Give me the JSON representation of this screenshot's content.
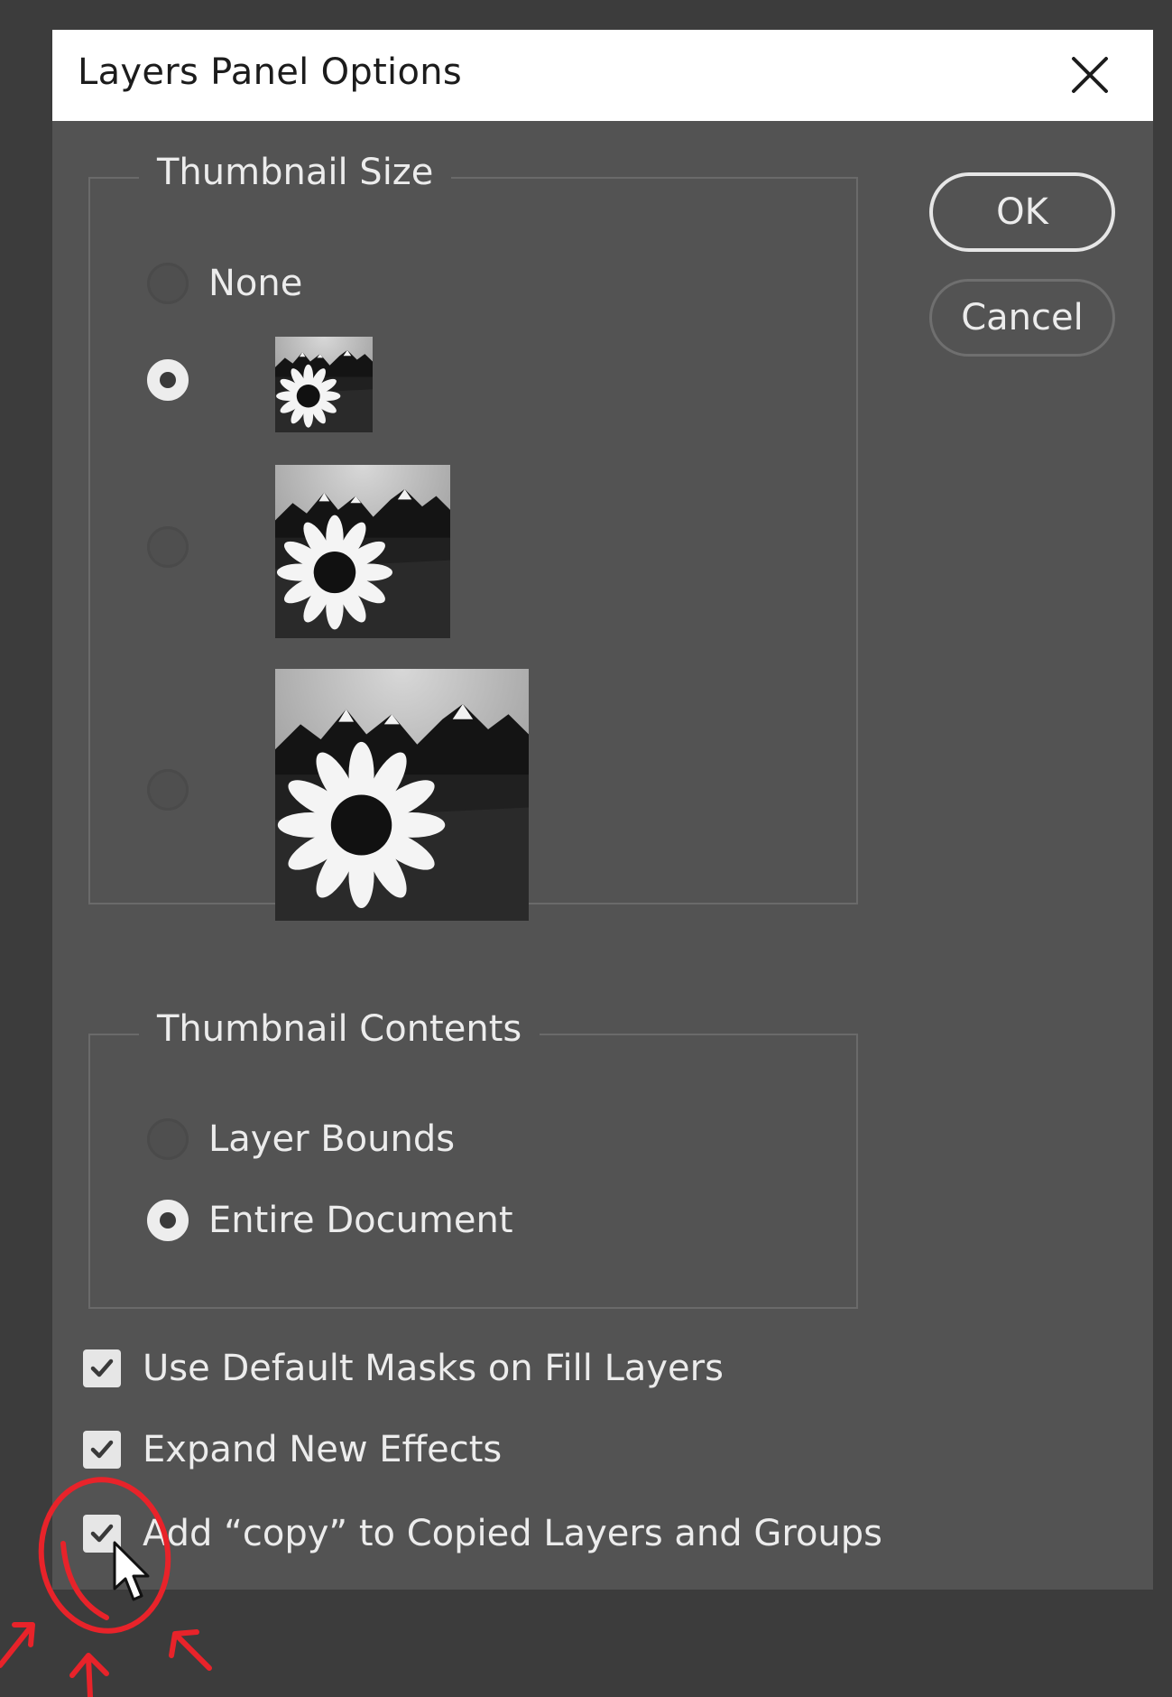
{
  "dialog": {
    "title": "Layers Panel Options",
    "close_icon": "close-icon"
  },
  "thumbnail_size": {
    "legend": "Thumbnail Size",
    "options": [
      {
        "label": "None",
        "selected": false
      },
      {
        "label": "",
        "size": "small",
        "selected": true
      },
      {
        "label": "",
        "size": "medium",
        "selected": false
      },
      {
        "label": "",
        "size": "large",
        "selected": false
      }
    ]
  },
  "thumbnail_contents": {
    "legend": "Thumbnail Contents",
    "options": [
      {
        "label": "Layer Bounds",
        "selected": false
      },
      {
        "label": "Entire Document",
        "selected": true
      }
    ]
  },
  "buttons": {
    "ok_label": "OK",
    "cancel_label": "Cancel"
  },
  "checkboxes": [
    {
      "label": "Use Default Masks on Fill Layers",
      "checked": true
    },
    {
      "label": "Expand New Effects",
      "checked": true
    },
    {
      "label": "Add “copy” to Copied Layers and Groups",
      "checked": true
    }
  ],
  "colors": {
    "dialog_bg": "#535353",
    "titlebar_bg": "#ffffff",
    "annotation_red": "#e8232a"
  },
  "icons": [
    "close-icon",
    "checkmark-icon",
    "mouse-pointer-icon",
    "sunflower-thumbnail"
  ]
}
